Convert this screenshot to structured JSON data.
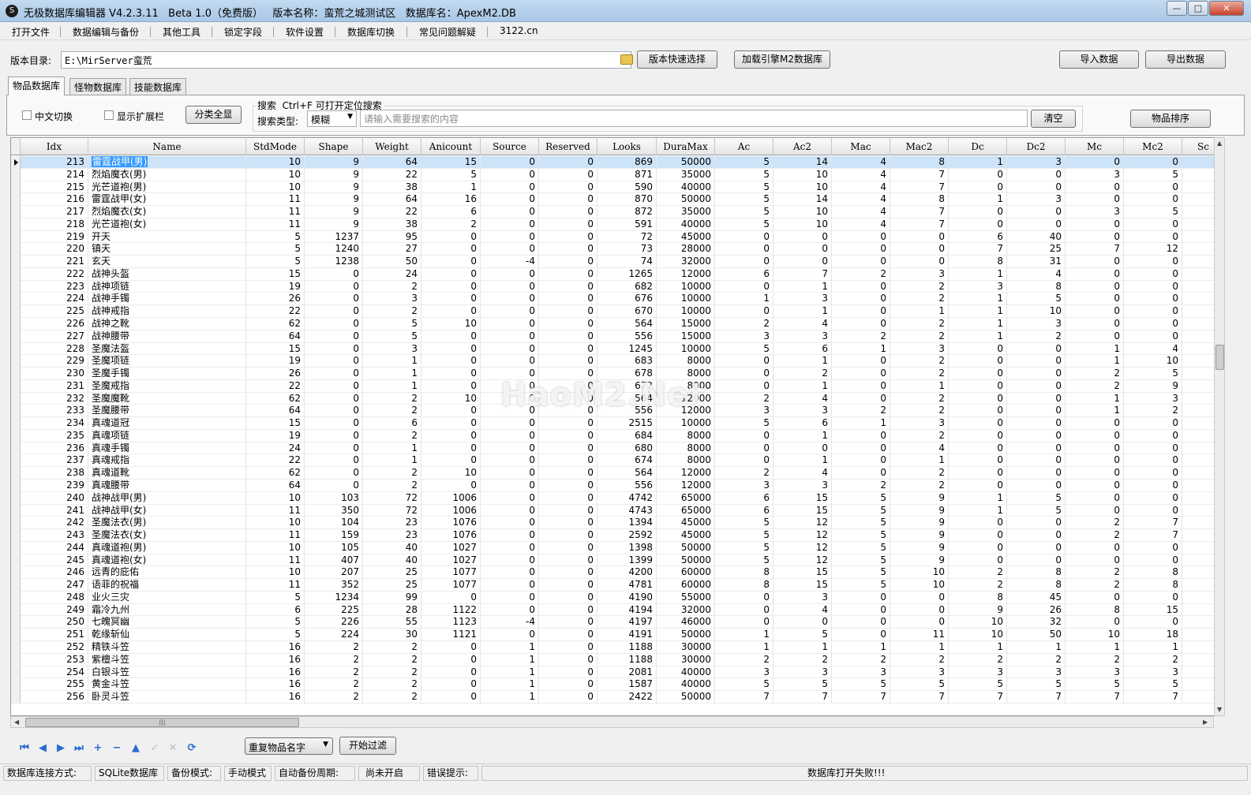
{
  "window": {
    "title": "无极数据库编辑器 V4.2.3.11   Beta 1.0（免费版）   版本名称：蛮荒之城测试区   数据库名：ApexM2.DB",
    "icon": "app-logo-icon"
  },
  "menu": [
    "打开文件",
    "数据编辑与备份",
    "其他工具",
    "锁定字段",
    "软件设置",
    "数据库切换",
    "常见问题解疑",
    "3122.cn"
  ],
  "toolbar": {
    "path_label": "版本目录:",
    "path_value": "E:\\MirServer蛮荒",
    "quick_select": "版本快速选择",
    "load_engine": "加载引擎M2数据库",
    "import": "导入数据",
    "export": "导出数据"
  },
  "tabs": [
    "物品数据库",
    "怪物数据库",
    "技能数据库"
  ],
  "filters": {
    "chinese_switch": "中文切换",
    "show_ext": "显示扩展栏",
    "category_all": "分类全显",
    "search_title": "搜索  Ctrl+F 可打开定位搜索",
    "search_type_label": "搜索类型:",
    "search_type_value": "模糊",
    "search_placeholder": "请输入需要搜索的内容",
    "clear": "清空",
    "sort": "物品排序"
  },
  "grid": {
    "columns": [
      "Idx",
      "Name",
      "StdMode",
      "Shape",
      "Weight",
      "Anicount",
      "Source",
      "Reserved",
      "Looks",
      "DuraMax",
      "Ac",
      "Ac2",
      "Mac",
      "Mac2",
      "Dc",
      "Dc2",
      "Mc",
      "Mc2",
      "Sc"
    ],
    "selected_index": 0,
    "rows": [
      [
        213,
        "雷霆战甲(男)",
        10,
        9,
        64,
        15,
        0,
        0,
        869,
        50000,
        5,
        14,
        4,
        8,
        1,
        3,
        0,
        0
      ],
      [
        214,
        "烈焰魔衣(男)",
        10,
        9,
        22,
        5,
        0,
        0,
        871,
        35000,
        5,
        10,
        4,
        7,
        0,
        0,
        3,
        5
      ],
      [
        215,
        "光芒道袍(男)",
        10,
        9,
        38,
        1,
        0,
        0,
        590,
        40000,
        5,
        10,
        4,
        7,
        0,
        0,
        0,
        0
      ],
      [
        216,
        "雷霆战甲(女)",
        11,
        9,
        64,
        16,
        0,
        0,
        870,
        50000,
        5,
        14,
        4,
        8,
        1,
        3,
        0,
        0
      ],
      [
        217,
        "烈焰魔衣(女)",
        11,
        9,
        22,
        6,
        0,
        0,
        872,
        35000,
        5,
        10,
        4,
        7,
        0,
        0,
        3,
        5
      ],
      [
        218,
        "光芒道袍(女)",
        11,
        9,
        38,
        2,
        0,
        0,
        591,
        40000,
        5,
        10,
        4,
        7,
        0,
        0,
        0,
        0
      ],
      [
        219,
        "开天",
        5,
        1237,
        95,
        0,
        0,
        0,
        72,
        45000,
        0,
        0,
        0,
        0,
        6,
        40,
        0,
        0
      ],
      [
        220,
        "镇天",
        5,
        1240,
        27,
        0,
        0,
        0,
        73,
        28000,
        0,
        0,
        0,
        0,
        7,
        25,
        7,
        12
      ],
      [
        221,
        "玄天",
        5,
        1238,
        50,
        0,
        -4,
        0,
        74,
        32000,
        0,
        0,
        0,
        0,
        8,
        31,
        0,
        0
      ],
      [
        222,
        "战神头盔",
        15,
        0,
        24,
        0,
        0,
        0,
        1265,
        12000,
        6,
        7,
        2,
        3,
        1,
        4,
        0,
        0
      ],
      [
        223,
        "战神项链",
        19,
        0,
        2,
        0,
        0,
        0,
        682,
        10000,
        0,
        1,
        0,
        2,
        3,
        8,
        0,
        0
      ],
      [
        224,
        "战神手镯",
        26,
        0,
        3,
        0,
        0,
        0,
        676,
        10000,
        1,
        3,
        0,
        2,
        1,
        5,
        0,
        0
      ],
      [
        225,
        "战神戒指",
        22,
        0,
        2,
        0,
        0,
        0,
        670,
        10000,
        0,
        1,
        0,
        1,
        1,
        10,
        0,
        0
      ],
      [
        226,
        "战神之靴",
        62,
        0,
        5,
        10,
        0,
        0,
        564,
        15000,
        2,
        4,
        0,
        2,
        1,
        3,
        0,
        0
      ],
      [
        227,
        "战神腰带",
        64,
        0,
        5,
        0,
        0,
        0,
        556,
        15000,
        3,
        3,
        2,
        2,
        1,
        2,
        0,
        0
      ],
      [
        228,
        "圣魔法盔",
        15,
        0,
        3,
        0,
        0,
        0,
        1245,
        10000,
        5,
        6,
        1,
        3,
        0,
        0,
        1,
        4
      ],
      [
        229,
        "圣魔项链",
        19,
        0,
        1,
        0,
        0,
        0,
        683,
        8000,
        0,
        1,
        0,
        2,
        0,
        0,
        1,
        10
      ],
      [
        230,
        "圣魔手镯",
        26,
        0,
        1,
        0,
        0,
        0,
        678,
        8000,
        0,
        2,
        0,
        2,
        0,
        0,
        2,
        5
      ],
      [
        231,
        "圣魔戒指",
        22,
        0,
        1,
        0,
        0,
        0,
        672,
        8000,
        0,
        1,
        0,
        1,
        0,
        0,
        2,
        9
      ],
      [
        232,
        "圣魔魔靴",
        62,
        0,
        2,
        10,
        0,
        0,
        564,
        12000,
        2,
        4,
        0,
        2,
        0,
        0,
        1,
        3
      ],
      [
        233,
        "圣魔腰带",
        64,
        0,
        2,
        0,
        0,
        0,
        556,
        12000,
        3,
        3,
        2,
        2,
        0,
        0,
        1,
        2
      ],
      [
        234,
        "真魂道冠",
        15,
        0,
        6,
        0,
        0,
        0,
        2515,
        10000,
        5,
        6,
        1,
        3,
        0,
        0,
        0,
        0
      ],
      [
        235,
        "真魂项链",
        19,
        0,
        2,
        0,
        0,
        0,
        684,
        8000,
        0,
        1,
        0,
        2,
        0,
        0,
        0,
        0
      ],
      [
        236,
        "真魂手镯",
        24,
        0,
        1,
        0,
        0,
        0,
        680,
        8000,
        0,
        0,
        0,
        4,
        0,
        0,
        0,
        0
      ],
      [
        237,
        "真魂戒指",
        22,
        0,
        1,
        0,
        0,
        0,
        674,
        8000,
        0,
        1,
        0,
        1,
        0,
        0,
        0,
        0
      ],
      [
        238,
        "真魂道靴",
        62,
        0,
        2,
        10,
        0,
        0,
        564,
        12000,
        2,
        4,
        0,
        2,
        0,
        0,
        0,
        0
      ],
      [
        239,
        "真魂腰带",
        64,
        0,
        2,
        0,
        0,
        0,
        556,
        12000,
        3,
        3,
        2,
        2,
        0,
        0,
        0,
        0
      ],
      [
        240,
        "战神战甲(男)",
        10,
        103,
        72,
        1006,
        0,
        0,
        4742,
        65000,
        6,
        15,
        5,
        9,
        1,
        5,
        0,
        0
      ],
      [
        241,
        "战神战甲(女)",
        11,
        350,
        72,
        1006,
        0,
        0,
        4743,
        65000,
        6,
        15,
        5,
        9,
        1,
        5,
        0,
        0
      ],
      [
        242,
        "圣魔法衣(男)",
        10,
        104,
        23,
        1076,
        0,
        0,
        1394,
        45000,
        5,
        12,
        5,
        9,
        0,
        0,
        2,
        7
      ],
      [
        243,
        "圣魔法衣(女)",
        11,
        159,
        23,
        1076,
        0,
        0,
        2592,
        45000,
        5,
        12,
        5,
        9,
        0,
        0,
        2,
        7
      ],
      [
        244,
        "真魂道袍(男)",
        10,
        105,
        40,
        1027,
        0,
        0,
        1398,
        50000,
        5,
        12,
        5,
        9,
        0,
        0,
        0,
        0
      ],
      [
        245,
        "真魂道袍(女)",
        11,
        407,
        40,
        1027,
        0,
        0,
        1399,
        50000,
        5,
        12,
        5,
        9,
        0,
        0,
        0,
        0
      ],
      [
        246,
        "远青的庇佑",
        10,
        207,
        25,
        1077,
        0,
        0,
        4200,
        60000,
        8,
        15,
        5,
        10,
        2,
        8,
        2,
        8
      ],
      [
        247,
        "语菲的祝福",
        11,
        352,
        25,
        1077,
        0,
        0,
        4781,
        60000,
        8,
        15,
        5,
        10,
        2,
        8,
        2,
        8
      ],
      [
        248,
        "业火三灾",
        5,
        1234,
        99,
        0,
        0,
        0,
        4190,
        55000,
        0,
        3,
        0,
        0,
        8,
        45,
        0,
        0
      ],
      [
        249,
        "霜冷九州",
        6,
        225,
        28,
        1122,
        0,
        0,
        4194,
        32000,
        0,
        4,
        0,
        0,
        9,
        26,
        8,
        15
      ],
      [
        250,
        "七魄冥幽",
        5,
        226,
        55,
        1123,
        -4,
        0,
        4197,
        46000,
        0,
        0,
        0,
        0,
        10,
        32,
        0,
        0
      ],
      [
        251,
        "乾缘斩仙",
        5,
        224,
        30,
        1121,
        0,
        0,
        4191,
        50000,
        1,
        5,
        0,
        11,
        10,
        50,
        10,
        18
      ],
      [
        252,
        "精铁斗笠",
        16,
        2,
        2,
        0,
        1,
        0,
        1188,
        30000,
        1,
        1,
        1,
        1,
        1,
        1,
        1,
        1
      ],
      [
        253,
        "紫檀斗笠",
        16,
        2,
        2,
        0,
        1,
        0,
        1188,
        30000,
        2,
        2,
        2,
        2,
        2,
        2,
        2,
        2
      ],
      [
        254,
        "白银斗笠",
        16,
        2,
        2,
        0,
        1,
        0,
        2081,
        40000,
        3,
        3,
        3,
        3,
        3,
        3,
        3,
        3
      ],
      [
        255,
        "黄金斗笠",
        16,
        2,
        2,
        0,
        1,
        0,
        1587,
        40000,
        5,
        5,
        5,
        5,
        5,
        5,
        5,
        5
      ],
      [
        256,
        "卧灵斗笠",
        16,
        2,
        2,
        0,
        1,
        0,
        2422,
        50000,
        7,
        7,
        7,
        7,
        7,
        7,
        7,
        7
      ]
    ]
  },
  "navigator": {
    "icons": [
      "first-icon",
      "prior-icon",
      "next-icon",
      "last-icon",
      "insert-icon",
      "delete-icon",
      "edit-icon",
      "post-icon",
      "cancel-icon",
      "refresh-icon"
    ],
    "filter_value": "重复物品名字",
    "filter_button": "开始过滤"
  },
  "status": {
    "conn_label": "数据库连接方式:",
    "conn_value": "SQLite数据库",
    "backup_label": "备份模式:",
    "backup_value": "手动模式",
    "auto_label": "自动备份周期:",
    "auto_value": "尚未开启",
    "error_label": "错误提示:",
    "error_value": "数据库打开失败!!!"
  },
  "watermark": "HaoM2.Net"
}
